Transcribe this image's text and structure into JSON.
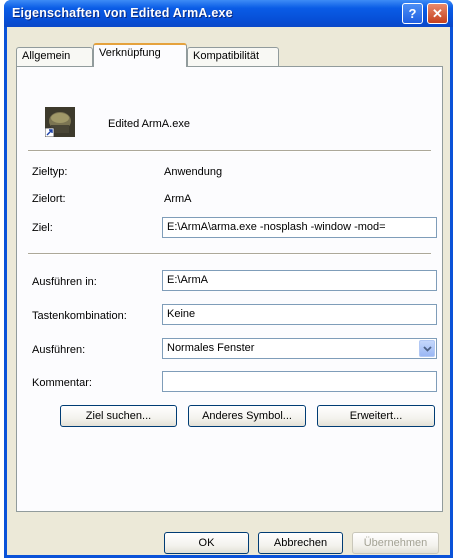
{
  "window": {
    "title": "Eigenschaften von Edited ArmA.exe",
    "help_label": "?",
    "close_label": "✕"
  },
  "tabs": [
    {
      "label": "Allgemein"
    },
    {
      "label": "Verknüpfung"
    },
    {
      "label": "Kompatibilität"
    }
  ],
  "shortcut": {
    "name": "Edited ArmA.exe",
    "zieltyp_label": "Zieltyp:",
    "zieltyp_value": "Anwendung",
    "zielort_label": "Zielort:",
    "zielort_value": "ArmA",
    "ziel_label": "Ziel:",
    "ziel_value": "E:\\ArmA\\arma.exe -nosplash -window -mod=",
    "ausfuehren_in_label": "Ausführen in:",
    "ausfuehren_in_value": "E:\\ArmA",
    "tasten_label": "Tastenkombination:",
    "tasten_value": "Keine",
    "ausfuehren_label": "Ausführen:",
    "ausfuehren_value": "Normales Fenster",
    "kommentar_label": "Kommentar:",
    "kommentar_value": ""
  },
  "buttons": {
    "ziel_suchen": "Ziel suchen...",
    "anderes_symbol": "Anderes Symbol...",
    "erweitert": "Erweitert..."
  },
  "footer": {
    "ok": "OK",
    "abbrechen": "Abbrechen",
    "uebernehmen": "Übernehmen"
  }
}
